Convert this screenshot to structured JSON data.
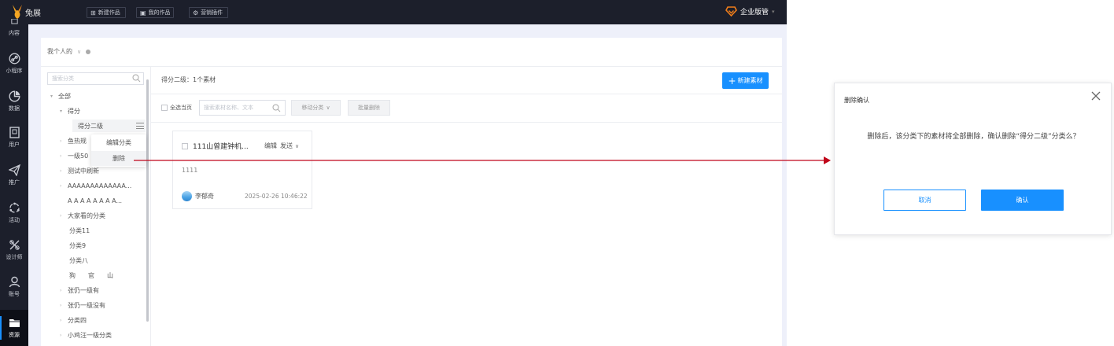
{
  "app": {
    "logo_text": "兔展",
    "enterprise_name": "企业版管"
  },
  "topbar": {
    "buttons": [
      {
        "icon": "plus-square-icon",
        "label": "新建作品"
      },
      {
        "icon": "doc-icon",
        "label": "我的作品"
      },
      {
        "icon": "gear-icon",
        "label": "营销插件"
      }
    ]
  },
  "rail": [
    {
      "icon": "content-icon",
      "label": "内容"
    },
    {
      "icon": "link-icon",
      "label": "小程序"
    },
    {
      "icon": "pie-icon",
      "label": "数据"
    },
    {
      "icon": "user-card-icon",
      "label": "用户"
    },
    {
      "icon": "send-icon",
      "label": "推广"
    },
    {
      "icon": "activity-icon",
      "label": "活动"
    },
    {
      "icon": "design-icon",
      "label": "设计师"
    },
    {
      "icon": "account-icon",
      "label": "账号"
    },
    {
      "icon": "folder-icon",
      "label": "资源"
    }
  ],
  "scope": {
    "label": "我个人的"
  },
  "tree": {
    "search_placeholder": "搜索分类",
    "nodes": [
      {
        "label": "全部",
        "caret": "▾"
      },
      {
        "label": "得分",
        "caret": "▾"
      },
      {
        "label": "得分二级",
        "caret": ""
      },
      {
        "label": "鱼热规",
        "caret": "›"
      },
      {
        "label": "一级50",
        "caret": "›"
      },
      {
        "label": "测试中刷新",
        "caret": "›"
      },
      {
        "label": "AAAAAAAAAAAAA...",
        "caret": "›"
      },
      {
        "label": "A A A A A A A A...",
        "caret": ""
      },
      {
        "label": "大家看的分类",
        "caret": "›"
      },
      {
        "label": "分类11",
        "caret": ""
      },
      {
        "label": "分类9",
        "caret": ""
      },
      {
        "label": "分类八",
        "caret": ""
      },
      {
        "label": "狗　　官　　山",
        "caret": ""
      },
      {
        "label": "张仍一级有",
        "caret": "›"
      },
      {
        "label": "张仍一级没有",
        "caret": "›"
      },
      {
        "label": "分类四",
        "caret": "›"
      },
      {
        "label": "小鸡汪一级分类",
        "caret": "›"
      }
    ],
    "context_menu": {
      "edit": "编辑分类",
      "delete": "删除"
    }
  },
  "content": {
    "breadcrumb": "得分二级：1个素材",
    "new_button": "新建素材",
    "select_all": "全选当页",
    "search_placeholder": "搜索素材名称、文本",
    "move_button": "移动分类",
    "batch_delete": "批量删除"
  },
  "card": {
    "title": "111山曾建钟机...",
    "edit": "编辑",
    "send": "发送",
    "body": "1111",
    "author": "李郁奇",
    "time": "2025-02-26 10:46:22"
  },
  "dialog": {
    "title": "删除确认",
    "message": "删除后，该分类下的素材将全部删除，确认删除“得分二级”分类么？",
    "cancel": "取消",
    "confirm": "确认"
  },
  "colors": {
    "primary": "#1890ff",
    "connector": "#c0061a",
    "dark_bg": "#1c1f2b",
    "brand": "#f5a623"
  }
}
